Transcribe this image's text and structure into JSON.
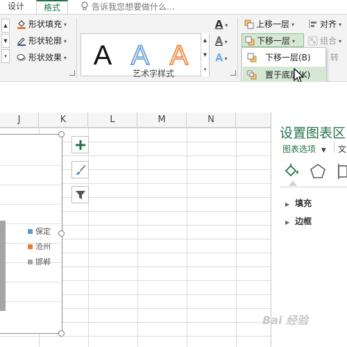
{
  "tabs": {
    "design": "设计",
    "format": "格式"
  },
  "tell_me": {
    "placeholder": "告诉我您想要做什么..."
  },
  "shape_styles": {
    "fill": "形状填充",
    "outline": "形状轮廓",
    "effects": "形状效果"
  },
  "wordart": {
    "group_label": "艺术字样式",
    "samples": [
      {
        "letter": "A",
        "style": "black"
      },
      {
        "letter": "A",
        "style": "blue-outline"
      },
      {
        "letter": "A",
        "style": "orange-outline"
      }
    ],
    "text_fill_glyph": "A",
    "text_outline_glyph": "A",
    "text_effects_glyph": "A"
  },
  "arrange": {
    "bring_forward": "上移一层",
    "send_backward": "下移一层",
    "align": "对齐",
    "group": "组合",
    "rotate": "转"
  },
  "send_menu": {
    "items": [
      {
        "label": "下移一层(B)"
      },
      {
        "label": "置于底层(K)"
      }
    ]
  },
  "columns": [
    "J",
    "K",
    "L",
    "M",
    "N"
  ],
  "chart": {
    "legend": [
      {
        "name": "保定",
        "color": "#5b9bd5"
      },
      {
        "name": "沧州",
        "color": "#ed7d31"
      },
      {
        "name": "邯郸",
        "color": "#a5a5a5"
      }
    ],
    "tools": [
      "chart-elements",
      "chart-styles",
      "chart-filters"
    ]
  },
  "task_pane": {
    "title": "设置图表区",
    "tab_chart_options": "图表选项",
    "tab_text": "文",
    "sections": [
      "填充",
      "边框"
    ]
  },
  "colors": {
    "accent": "#217346",
    "ribbon_bg": "#f3f3f3",
    "menu_hover": "#d5e8d4"
  },
  "watermark": "Bai 经验"
}
